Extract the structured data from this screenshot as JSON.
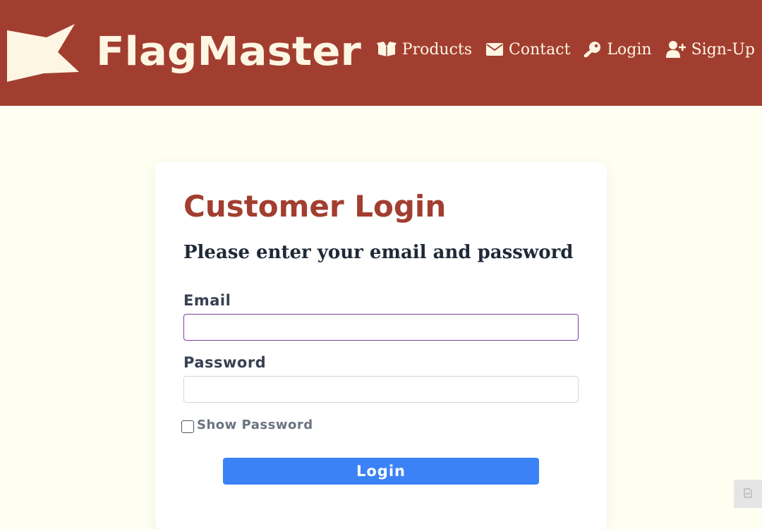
{
  "header": {
    "brand": "FlagMaster",
    "background_color": "#a23e30",
    "text_color": "#fdf6e3",
    "logo_icon": "flag-icon",
    "nav": [
      {
        "label": "Products",
        "icon": "box-open-icon"
      },
      {
        "label": "Contact",
        "icon": "envelope-icon"
      },
      {
        "label": "Login",
        "icon": "key-icon"
      },
      {
        "label": "Sign-Up",
        "icon": "user-plus-icon"
      }
    ]
  },
  "login": {
    "title": "Customer Login",
    "subtitle": "Please enter your email and password",
    "email_label": "Email",
    "email_value": "",
    "password_label": "Password",
    "password_value": "",
    "show_password_label": "Show Password",
    "show_password_checked": false,
    "submit_label": "Login",
    "accent_color": "#3b82f6",
    "title_color": "#a23e30"
  },
  "page": {
    "background_color": "#fefff0",
    "corner_icon": "document-icon"
  }
}
